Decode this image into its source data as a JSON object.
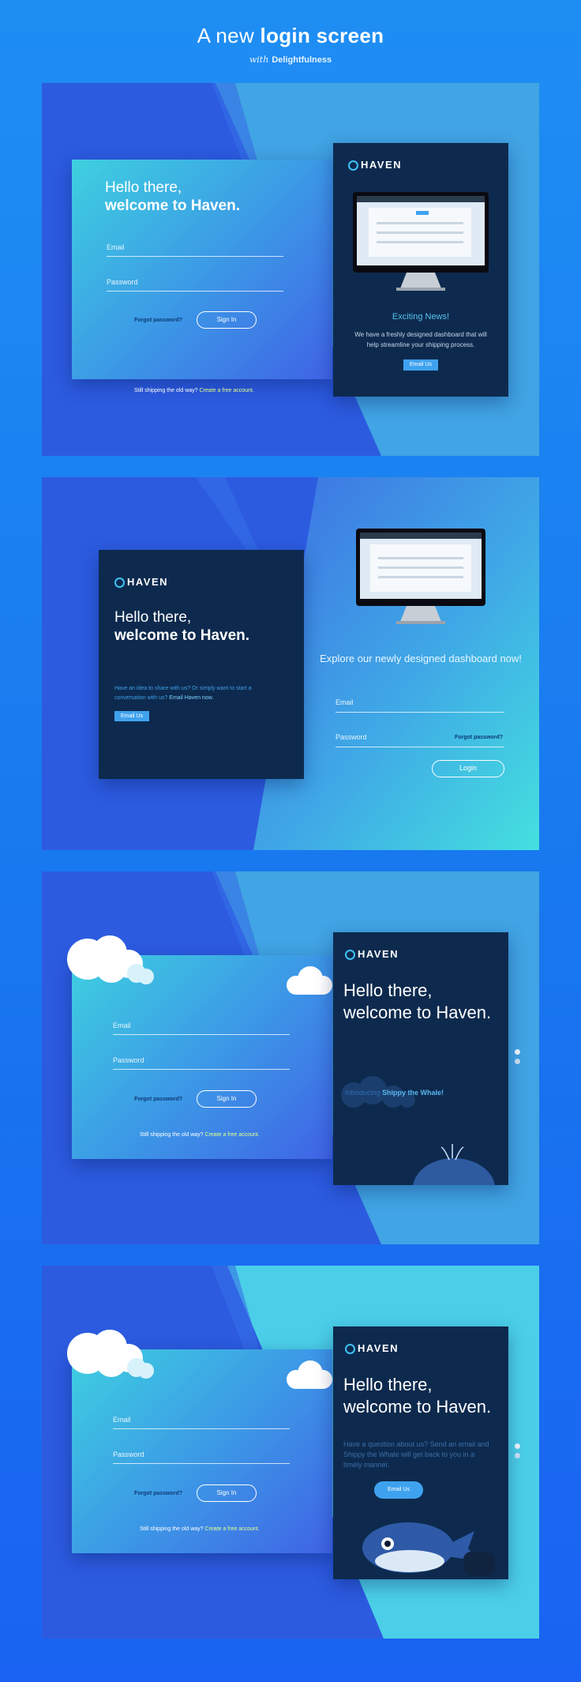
{
  "header": {
    "title_light": "A new",
    "title_bold": "login screen",
    "sub_italic": "with",
    "sub_bold": "Delightfulness"
  },
  "common": {
    "brand": "HAVEN",
    "hello": "Hello there,",
    "welcome": "welcome to Haven.",
    "email": "Email",
    "password": "Password",
    "forgot": "Forgot password?",
    "sign_in": "Sign In",
    "login": "Login",
    "footer_text": "Still shipping the old way?",
    "footer_link": "Create a free account.",
    "email_us": "Email Us"
  },
  "panel1": {
    "news_title": "Exciting News!",
    "news_body": "We have a freshly designed dashboard that will help streamline your shipping process."
  },
  "panel2": {
    "message": "Have an idea to share with us? Or simply want to start a conversation with us?",
    "message_link": "Email Haven now.",
    "explore": "Explore our newly designed dashboard now!"
  },
  "panel3": {
    "intro_text": "Introducing",
    "intro_link": "Shippy the Whale!"
  },
  "panel4": {
    "question": "Have a question about us? Send an email and Shippy the Whale will get back to you in a timely manner."
  },
  "colors": {
    "accent": "#3fa2ef",
    "dark_card": "#0d2a4e",
    "link_highlight": "#e3ff8a"
  }
}
